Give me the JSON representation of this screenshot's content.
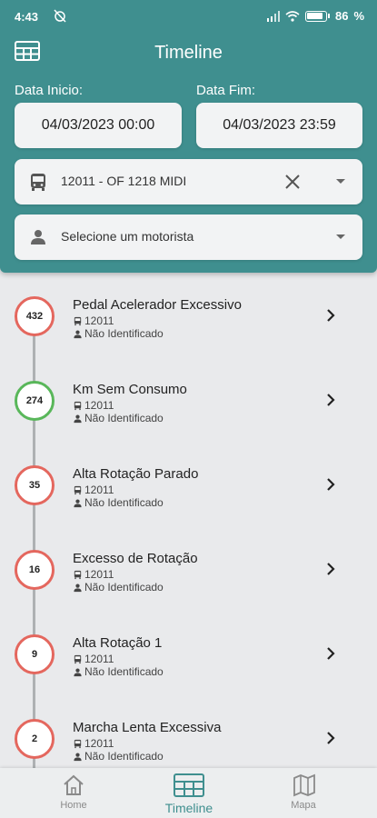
{
  "status": {
    "time": "4:43",
    "battery": "86"
  },
  "header": {
    "title": "Timeline",
    "start_label": "Data Inicio:",
    "end_label": "Data Fim:",
    "start_value": "04/03/2023 00:00",
    "end_value": "04/03/2023 23:59",
    "vehicle": "12011 - OF 1218 MIDI",
    "driver_placeholder": "Selecione um motorista"
  },
  "events": [
    {
      "count": "432",
      "title": "Pedal Acelerador Excessivo",
      "vehicle": "12011",
      "driver": "Não Identificado",
      "status": "red"
    },
    {
      "count": "274",
      "title": "Km Sem Consumo",
      "vehicle": "12011",
      "driver": "Não Identificado",
      "status": "green"
    },
    {
      "count": "35",
      "title": "Alta Rotação Parado",
      "vehicle": "12011",
      "driver": "Não Identificado",
      "status": "red"
    },
    {
      "count": "16",
      "title": "Excesso de Rotação",
      "vehicle": "12011",
      "driver": "Não Identificado",
      "status": "red"
    },
    {
      "count": "9",
      "title": "Alta Rotação 1",
      "vehicle": "12011",
      "driver": "Não Identificado",
      "status": "red"
    },
    {
      "count": "2",
      "title": "Marcha Lenta Excessiva",
      "vehicle": "12011",
      "driver": "Não Identificado",
      "status": "red"
    }
  ],
  "nav": {
    "home": "Home",
    "timeline": "Timeline",
    "map": "Mapa"
  },
  "colors": {
    "primary": "#3f8f8f",
    "alert": "#e4675e",
    "ok": "#59b75a"
  },
  "icons": {
    "table": "table-icon",
    "bus": "bus-icon",
    "person": "person-icon",
    "clear": "close-icon",
    "caret": "caret-down-icon",
    "chevron": "chevron-right-icon",
    "home": "home-icon",
    "map": "map-icon"
  }
}
